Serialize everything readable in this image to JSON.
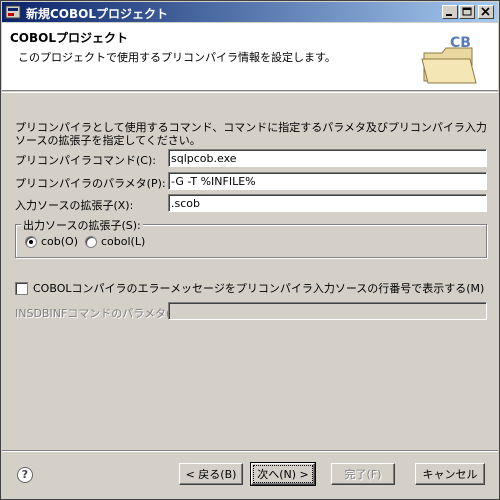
{
  "window": {
    "title": "新規COBOLプロジェクト"
  },
  "header": {
    "title": "COBOLプロジェクト",
    "description": "このプロジェクトで使用するプリコンパイラ情報を設定します。",
    "icon_text": "CB"
  },
  "form": {
    "intro": "プリコンパイラとして使用するコマンド、コマンドに指定するパラメタ及びプリコンパイラ入力ソースの拡張子を指定してください。",
    "command_label": "プリコンパイラコマンド(C):",
    "command_value": "sqlpcob.exe",
    "params_label": "プリコンパイラのパラメタ(P):",
    "params_value": "-G -T %INFILE%",
    "ext_label": "入力ソースの拡張子(X):",
    "ext_value": ".scob",
    "output_group_label": "出力ソースの拡張子(S):",
    "radio_cob": "cob(O)",
    "radio_cobol": "cobol(L)",
    "selected_output": "cob",
    "checkbox_label": "COBOLコンパイラのエラーメッセージをプリコンパイラ入力ソースの行番号で表示する(M)",
    "checkbox_checked": false,
    "insdbinf_label": "INSDBINFコマンドのパラメタ(F):",
    "insdbinf_value": ""
  },
  "buttons": {
    "back": "< 戻る(B)",
    "next": "次へ(N) >",
    "finish": "完了(F)",
    "cancel": "キャンセル"
  },
  "icons": {
    "help": "?",
    "minimize": "minimize-icon",
    "maximize": "maximize-icon",
    "close": "close-icon"
  }
}
